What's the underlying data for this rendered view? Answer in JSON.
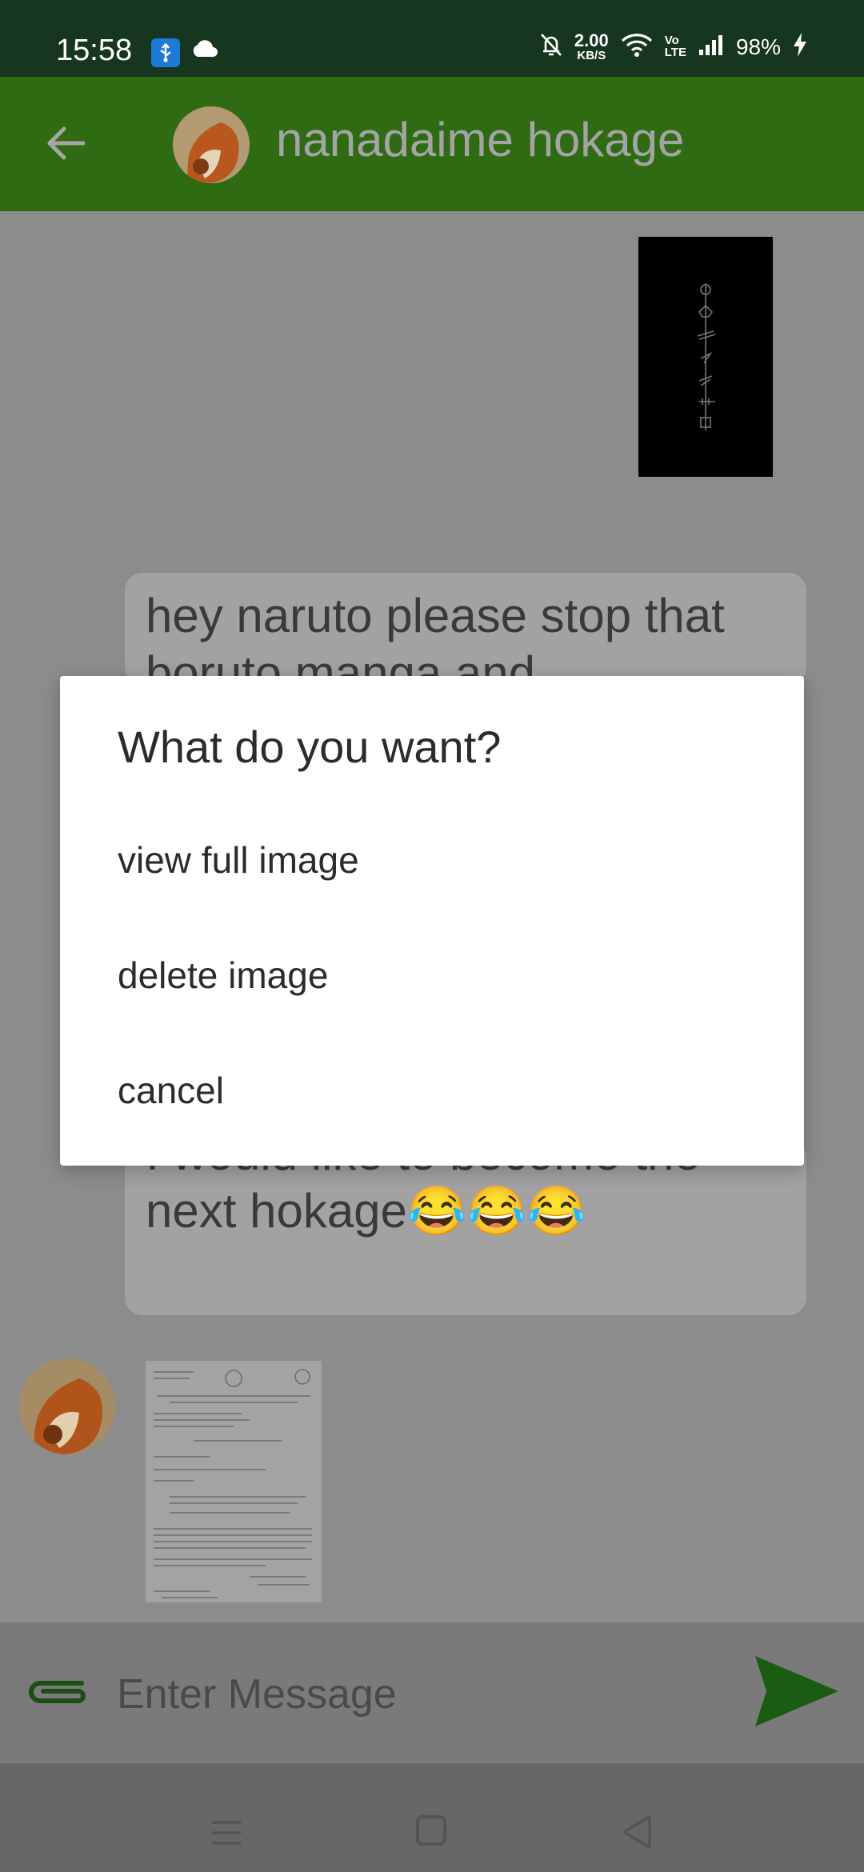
{
  "status_bar": {
    "time": "15:58",
    "net_speed_value": "2.00",
    "net_speed_unit": "KB/S",
    "volte_top": "Vo",
    "volte_bottom": "LTE",
    "battery": "98%"
  },
  "app_bar": {
    "title": "nanadaime hokage"
  },
  "messages": {
    "top_text": "hey naruto please stop that boruto manga and",
    "bottom_text": "I would like to become the next hokage😂😂😂"
  },
  "dialog": {
    "title": "What do you want?",
    "options": [
      "view full image",
      "delete image",
      "cancel"
    ]
  },
  "composer": {
    "placeholder": "Enter Message"
  },
  "colors": {
    "status_bar": "#17361f",
    "app_bar": "#2e6b12",
    "accent_green": "#1a6a14",
    "scrim_background": "#8c8c8c"
  }
}
